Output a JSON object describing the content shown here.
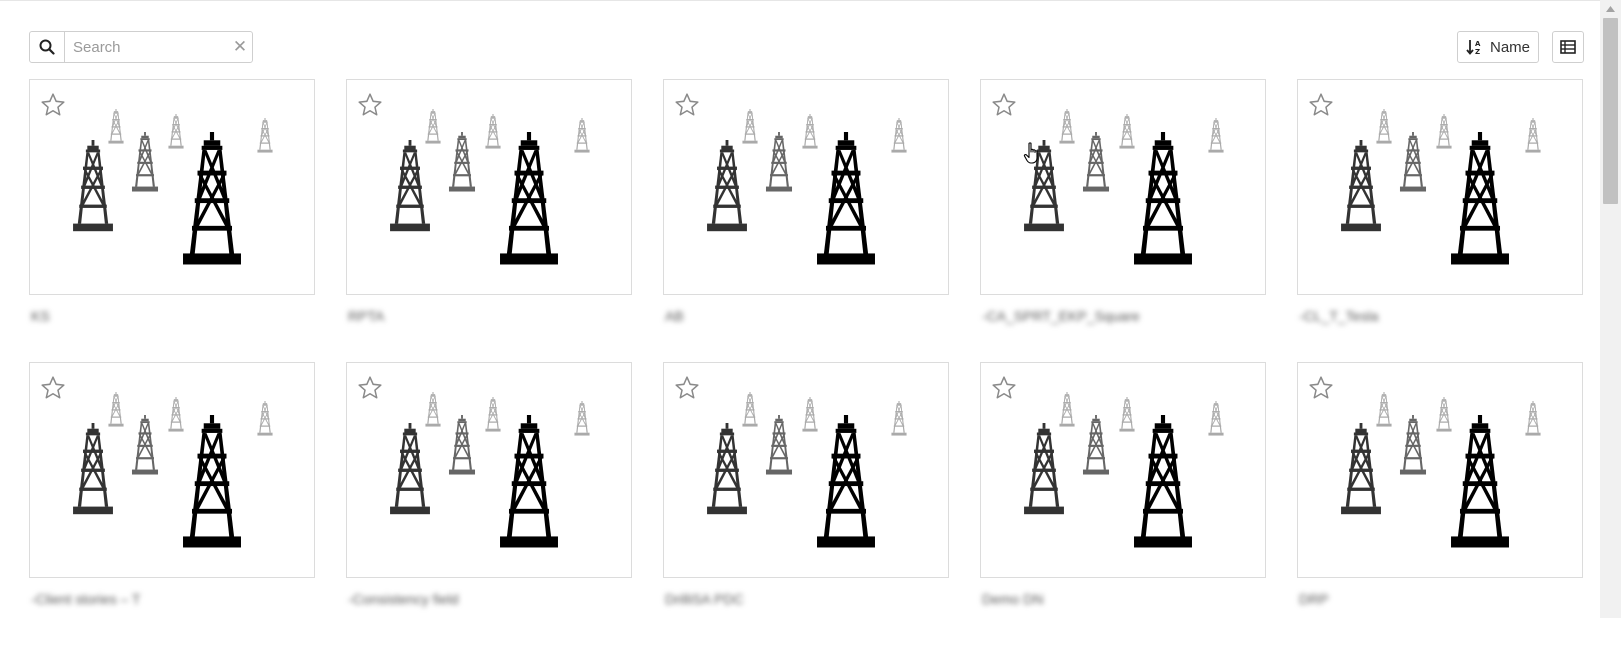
{
  "search": {
    "placeholder": "Search",
    "value": "",
    "icon": "search-icon",
    "clear_icon": "close-icon",
    "clear_glyph": "✕"
  },
  "toolbar": {
    "sort_label": "Name",
    "sort_icon": "sort-alpha-icon",
    "view_icon": "list-view-icon"
  },
  "cards": [
    {
      "title": "KS",
      "favorite": false,
      "thumbnail_icon": "oil-derrick-icon"
    },
    {
      "title": "RPTA",
      "favorite": false,
      "thumbnail_icon": "oil-derrick-icon"
    },
    {
      "title": "AB",
      "favorite": false,
      "thumbnail_icon": "oil-derrick-icon"
    },
    {
      "title": "-CA_SPRT_EKP_Square",
      "favorite": false,
      "thumbnail_icon": "oil-derrick-icon"
    },
    {
      "title": "-CL_T_Tesla",
      "favorite": false,
      "thumbnail_icon": "oil-derrick-icon"
    },
    {
      "title": "-Client stories – T",
      "favorite": false,
      "thumbnail_icon": "oil-derrick-icon"
    },
    {
      "title": "-Consistency field",
      "favorite": false,
      "thumbnail_icon": "oil-derrick-icon"
    },
    {
      "title": "DrilliSA PDC",
      "favorite": false,
      "thumbnail_icon": "oil-derrick-icon"
    },
    {
      "title": "Demo DN",
      "favorite": false,
      "thumbnail_icon": "oil-derrick-icon"
    },
    {
      "title": "DRP",
      "favorite": false,
      "thumbnail_icon": "oil-derrick-icon"
    }
  ],
  "colors": {
    "derrick_dark": "#000000",
    "derrick_mid": "#333333",
    "derrick_gray": "#666666",
    "derrick_light": "#aaaaaa",
    "border": "#dcdcdc"
  }
}
